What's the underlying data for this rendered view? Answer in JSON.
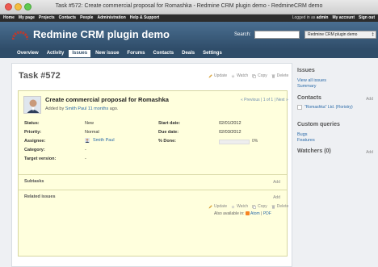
{
  "window": {
    "title": "Task #572: Create commercial proposal for Romashka - Redmine CRM plugin demo - RedmineCRM demo"
  },
  "topmenu": {
    "left": [
      "Home",
      "My page",
      "Projects",
      "Contacts",
      "People",
      "Administration",
      "Help & Support"
    ],
    "logged_in_prefix": "Logged in as",
    "user": "admin",
    "my_account": "My account",
    "sign_out": "Sign out"
  },
  "header": {
    "project_title": "Redmine CRM plugin demo",
    "search_label": "Search:",
    "search_value": "",
    "project_select": "Redmine CRM plugin demo",
    "project_select_suffix": "‡"
  },
  "tabs": [
    {
      "label": "Overview",
      "active": false
    },
    {
      "label": "Activity",
      "active": false
    },
    {
      "label": "Issues",
      "active": true
    },
    {
      "label": "New issue",
      "active": false
    },
    {
      "label": "Forums",
      "active": false
    },
    {
      "label": "Contacts",
      "active": false
    },
    {
      "label": "Deals",
      "active": false
    },
    {
      "label": "Settings",
      "active": false
    }
  ],
  "issue": {
    "title": "Task #572",
    "actions": {
      "update": "Update",
      "watch": "Watch",
      "copy": "Copy",
      "delete": "Delete"
    },
    "subject": "Create commercial proposal for Romashka",
    "added_by_prefix": "Added by",
    "author": "Smith Paul",
    "age": "11 months",
    "added_suffix": "ago.",
    "pager": "« Previous | 1 of 1 | Next »",
    "status_label": "Status:",
    "status": "New",
    "priority_label": "Priority:",
    "priority": "Normal",
    "assignee_label": "Assignee:",
    "assignee": "Smith Paul",
    "category_label": "Category:",
    "category": "-",
    "target_label": "Target version:",
    "target": "-",
    "start_label": "Start date:",
    "start": "02/01/2012",
    "due_label": "Due date:",
    "due": "02/03/2012",
    "done_label": "% Done:",
    "done": "0%",
    "done_fraction": 0,
    "subtasks_label": "Subtasks",
    "related_label": "Related issues",
    "add_label": "Add",
    "also_available_prefix": "Also available in:",
    "atom": "Atom",
    "pdf": "PDF"
  },
  "sidebar": {
    "issues_heading": "Issues",
    "view_all": "View all issues",
    "summary": "Summary",
    "contacts_heading": "Contacts",
    "contacts_add": "Add",
    "contact_name": "\"Romashka\" Ltd. (Floristry)",
    "custom_queries_heading": "Custom queries",
    "bugs": "Bugs",
    "features": "Features",
    "watchers_heading": "Watchers (0)",
    "watchers_add": "Add"
  },
  "colors": {
    "header": "#3e5b76",
    "link": "#2a6aa8",
    "issue_bg": "#ffffdd"
  }
}
